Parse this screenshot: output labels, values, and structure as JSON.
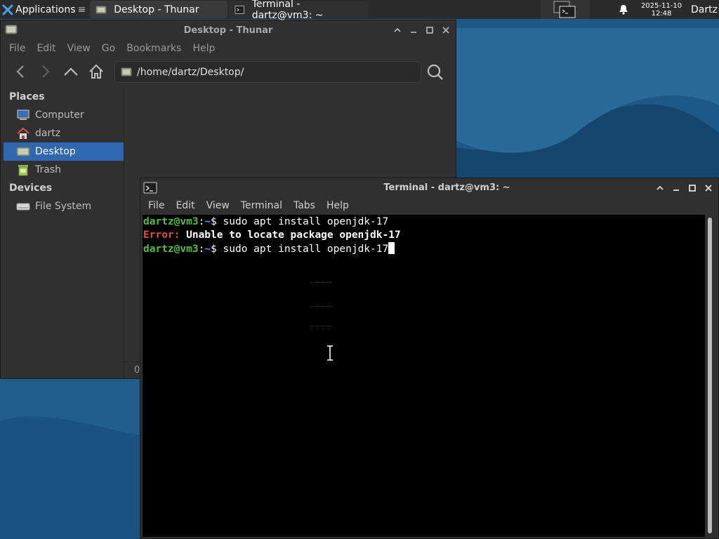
{
  "panel": {
    "apps_label": "Applications",
    "tasks": [
      {
        "label": "Desktop - Thunar"
      },
      {
        "label": "Terminal - dartz@vm3: ~"
      }
    ],
    "clock_date": "2025-11-10",
    "clock_time": "12:48",
    "user": "Dartz"
  },
  "thunar": {
    "title": "Desktop - Thunar",
    "menu": [
      "File",
      "Edit",
      "View",
      "Go",
      "Bookmarks",
      "Help"
    ],
    "location": "/home/dartz/Desktop/",
    "sidebar": {
      "places_header": "Places",
      "places": [
        {
          "label": "Computer",
          "icon": "computer-icon"
        },
        {
          "label": "dartz",
          "icon": "home-icon"
        },
        {
          "label": "Desktop",
          "icon": "desktop-icon",
          "selected": true
        },
        {
          "label": "Trash",
          "icon": "trash-icon"
        }
      ],
      "devices_header": "Devices",
      "devices": [
        {
          "label": "File System",
          "icon": "drive-icon"
        }
      ]
    },
    "status": "0"
  },
  "terminal": {
    "title": "Terminal - dartz@vm3: ~",
    "menu": [
      "File",
      "Edit",
      "View",
      "Terminal",
      "Tabs",
      "Help"
    ],
    "lines": [
      {
        "user": "dartz@vm3",
        "sep": ":",
        "path": "~",
        "prompt": "$ ",
        "cmd": "sudo apt install openjdk-17"
      },
      {
        "error_label": "Error:",
        "error_msg": " Unable to locate package openjdk-17"
      },
      {
        "user": "dartz@vm3",
        "sep": ":",
        "path": "~",
        "prompt": "$ ",
        "cmd": "sudo apt install openjdk-17"
      }
    ]
  },
  "colors": {
    "desktop_bg": "#1f5a8a",
    "selection": "#2e68b0",
    "prompt_user": "#4fc142",
    "prompt_path": "#5e8fd8",
    "error": "#e04b4b"
  }
}
